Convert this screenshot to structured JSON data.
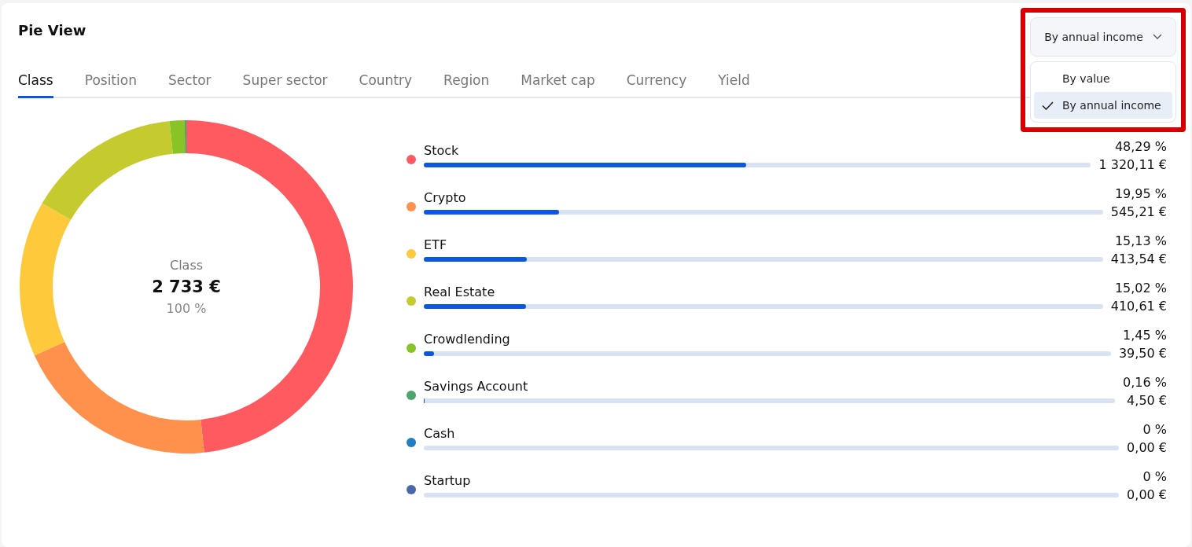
{
  "title": "Pie View",
  "tabs": [
    {
      "label": "Class",
      "selected": true
    },
    {
      "label": "Position",
      "selected": false
    },
    {
      "label": "Sector",
      "selected": false
    },
    {
      "label": "Super sector",
      "selected": false
    },
    {
      "label": "Country",
      "selected": false
    },
    {
      "label": "Region",
      "selected": false
    },
    {
      "label": "Market cap",
      "selected": false
    },
    {
      "label": "Currency",
      "selected": false
    },
    {
      "label": "Yield",
      "selected": false
    }
  ],
  "sort_dropdown": {
    "value": "By annual income",
    "expanded": true,
    "highlighted": true,
    "options": [
      {
        "label": "By value",
        "selected": false
      },
      {
        "label": "By annual income",
        "selected": true
      }
    ]
  },
  "donut": {
    "label": "Class",
    "total": "2 733 €",
    "share": "100 %",
    "chart_data": {
      "type": "donut",
      "values": [
        48.29,
        19.95,
        15.13,
        15.02,
        1.45,
        0.16,
        0,
        0
      ]
    }
  },
  "legend": [
    {
      "name": "Stock",
      "color": "#ff5a5f",
      "level": 0.4829,
      "percent": "48,29 %",
      "amount": "1 320,11 €"
    },
    {
      "name": "Crypto",
      "color": "#ff914d",
      "level": 0.1995,
      "percent": "19,95 %",
      "amount": "545,21 €"
    },
    {
      "name": "ETF",
      "color": "#ffc93c",
      "level": 0.1513,
      "percent": "15,13 %",
      "amount": "413,54 €"
    },
    {
      "name": "Real Estate",
      "color": "#c5cb2e",
      "level": 0.1502,
      "percent": "15,02 %",
      "amount": "410,61 €"
    },
    {
      "name": "Crowdlending",
      "color": "#88c425",
      "level": 0.0145,
      "percent": "1,45 %",
      "amount": "39,50 €"
    },
    {
      "name": "Savings Account",
      "color": "#4ca56f",
      "level": 0.0016,
      "percent": "0,16 %",
      "amount": "4,50 €"
    },
    {
      "name": "Cash",
      "color": "#1f7fc4",
      "level": 0,
      "percent": "0 %",
      "amount": "0,00 €"
    },
    {
      "name": "Startup",
      "color": "#4a68a8",
      "level": 0,
      "percent": "0 %",
      "amount": "0,00 €"
    }
  ]
}
